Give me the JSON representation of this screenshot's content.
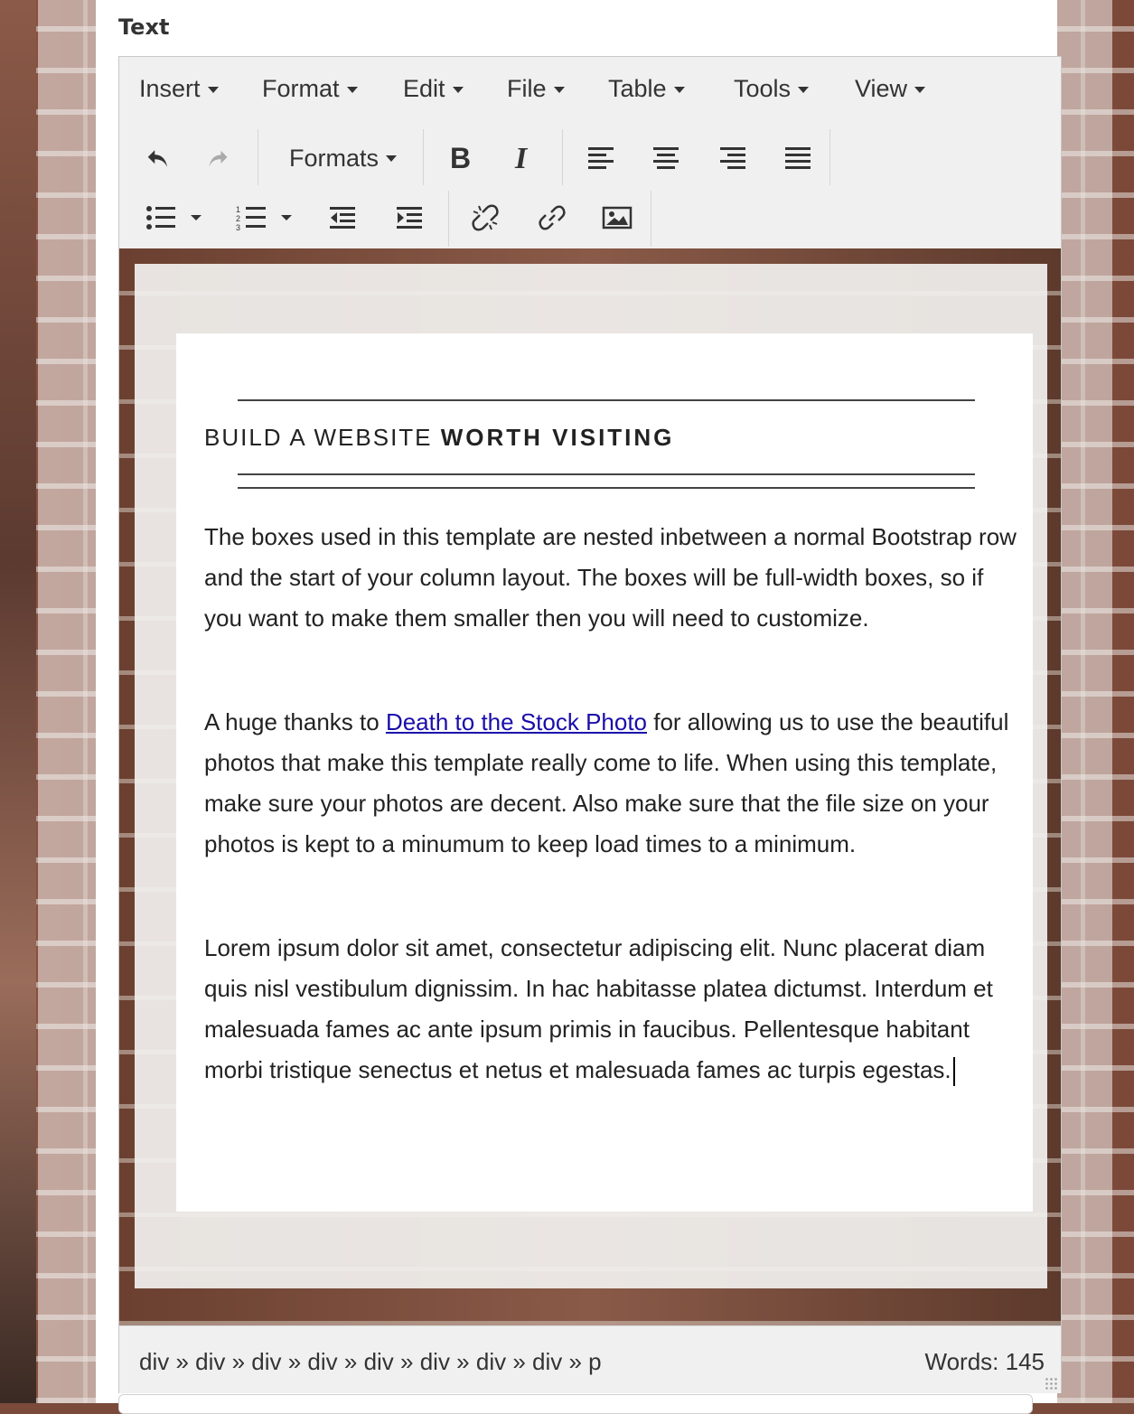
{
  "field": {
    "label": "Text"
  },
  "menubar": {
    "items": [
      {
        "label": "Insert"
      },
      {
        "label": "Format"
      },
      {
        "label": "Edit"
      },
      {
        "label": "File"
      },
      {
        "label": "Table"
      },
      {
        "label": "Tools"
      },
      {
        "label": "View"
      }
    ]
  },
  "toolbar": {
    "formats_label": "Formats",
    "buttons": [
      "undo-icon",
      "redo-icon",
      "bold-icon",
      "italic-icon",
      "align-left-icon",
      "align-center-icon",
      "align-right-icon",
      "align-justify-icon",
      "bullet-list-icon",
      "numbered-list-icon",
      "outdent-icon",
      "indent-icon",
      "unlink-icon",
      "link-icon",
      "image-icon"
    ]
  },
  "content": {
    "heading_light": "BUILD A WEBSITE ",
    "heading_bold": "WORTH VISITING",
    "para1": "The boxes used in this template are nested inbetween a normal Bootstrap row and the start of your column layout. The boxes will be full-width boxes, so if you want to make them smaller then you will need to customize.",
    "para2_before": "A huge thanks to ",
    "para2_link": "Death to the Stock Photo",
    "para2_after": " for allowing us to use the beautiful photos that make this template really come to life. When using this template, make sure your photos are decent. Also make sure that the file size on your photos is kept to a minumum to keep load times to a minimum.",
    "para3": "Lorem ipsum dolor sit amet, consectetur adipiscing elit. Nunc placerat diam quis nisl vestibulum dignissim. In hac habitasse platea dictumst. Interdum et malesuada fames ac ante ipsum primis in faucibus. Pellentesque habitant morbi tristique senectus et netus et malesuada fames ac turpis egestas."
  },
  "statusbar": {
    "path": "div » div » div » div » div » div » div » div » p",
    "wordcount": "Words: 145"
  },
  "colors": {
    "link": "#1a0dab",
    "toolbar_bg": "#f0f0f0"
  }
}
